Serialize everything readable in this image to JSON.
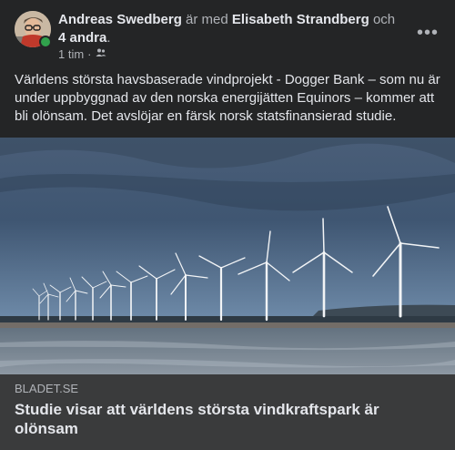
{
  "post": {
    "author": "Andreas Swedberg",
    "with_text": "är med",
    "tagged_person": "Elisabeth Strandberg",
    "and_text": "och",
    "others": "4 andra",
    "period": ".",
    "time": "1 tim",
    "separator": "·",
    "audience_icon": "friends-icon",
    "more_label": "•••",
    "text": "Världens största havsbaserade vindprojekt - Dogger Bank – som nu är under uppbyggnad av den norska energijätten Equinors – kommer att bli olönsam. Det avslöjar en färsk norsk statsfinansierad studie."
  },
  "link_preview": {
    "domain": "BLADET.SE",
    "title": "Studie visar att världens största vindkraftspark är olönsam"
  },
  "colors": {
    "card": "#242526",
    "link_box": "#3a3b3c",
    "online": "#31a24c",
    "sky": "#6e8aa6",
    "sea": "#7d8a96"
  }
}
